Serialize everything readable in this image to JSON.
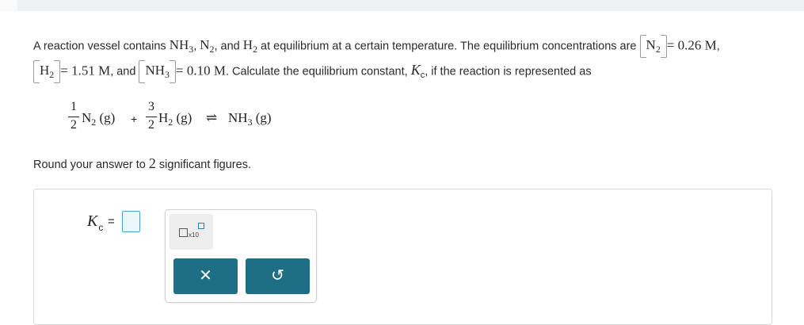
{
  "question": {
    "p1_a": "A reaction vessel contains ",
    "nh3": "NH",
    "nh3_sub": "3",
    "p1_b": ", ",
    "n2": "N",
    "n2_sub": "2",
    "p1_c": ", and ",
    "h2": "H",
    "h2_sub": "2",
    "p1_d": " at equilibrium at a certain temperature. The equilibrium concentrations are ",
    "n2_conc": "= 0.26 M",
    "p1_e": ",",
    "h2_conc": "= 1.51 M",
    "p2_a": ", and ",
    "nh3_conc": "= 0.10 M",
    "p2_b": ". Calculate the equilibrium constant, ",
    "k": "K",
    "k_sub": "c",
    "p2_c": ", if the reaction is represented as"
  },
  "equation": {
    "coef1_num": "1",
    "coef1_den": "2",
    "reactant1": "N",
    "reactant1_sub": "2",
    "reactant1_state": " (g)",
    "plus": "+",
    "coef2_num": "3",
    "coef2_den": "2",
    "reactant2": "H",
    "reactant2_sub": "2",
    "reactant2_state": " (g)",
    "arrow": "⇌",
    "product": "NH",
    "product_sub": "3",
    "product_state": " (g)"
  },
  "instruction": {
    "before": "Round your answer to ",
    "number": "2",
    "after": " significant figures."
  },
  "answer": {
    "label": "K",
    "label_sub": "c",
    "equals": "=",
    "value": ""
  },
  "tools": {
    "sci_notation_text": "x10",
    "sci_notation_icon": "scientific-notation-icon",
    "clear_glyph": "✕",
    "undo_glyph": "↺"
  },
  "colors": {
    "button_teal": "#1e6e86",
    "input_border": "#4aa3c7",
    "input_fill": "#eaf6fa"
  }
}
